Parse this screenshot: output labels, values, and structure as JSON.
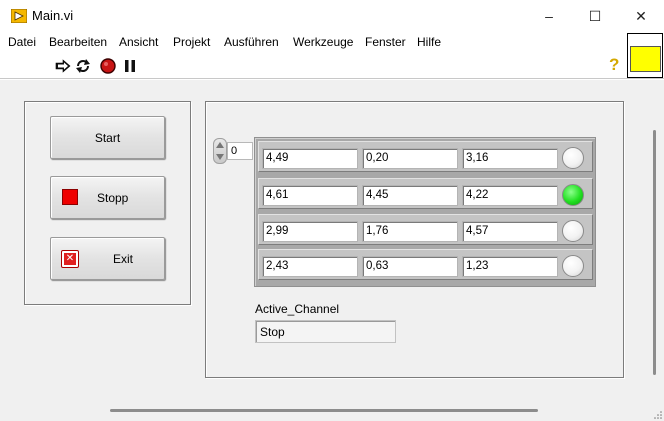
{
  "window": {
    "title": "Main.vi",
    "controls": {
      "minimize": "–",
      "maximize": "☐",
      "close": "✕"
    }
  },
  "menu": {
    "items": [
      "Datei",
      "Bearbeiten",
      "Ansicht",
      "Projekt",
      "Ausführen",
      "Werkzeuge",
      "Fenster",
      "Hilfe"
    ]
  },
  "toolbar": {
    "icons": [
      "run-arrow-icon",
      "run-continuously-icon",
      "abort-icon",
      "pause-icon"
    ],
    "help_label": "?"
  },
  "colors": {
    "led_on": "#21e021",
    "stop_red": "#ee0000",
    "connector_yellow": "#ffff00",
    "array_frame": "#a8a8a8"
  },
  "controls": {
    "start_label": "Start",
    "stop_label": "Stopp",
    "exit_label": "Exit",
    "exit_icon_glyph": "✕"
  },
  "array": {
    "index": "0",
    "rows": [
      {
        "values": [
          "4,49",
          "0,20",
          "3,16"
        ],
        "led": false
      },
      {
        "values": [
          "4,61",
          "4,45",
          "4,22"
        ],
        "led": true
      },
      {
        "values": [
          "2,99",
          "1,76",
          "4,57"
        ],
        "led": false
      },
      {
        "values": [
          "2,43",
          "0,63",
          "1,23"
        ],
        "led": false
      }
    ]
  },
  "active_channel": {
    "label": "Active_Channel",
    "value": "Stop"
  }
}
